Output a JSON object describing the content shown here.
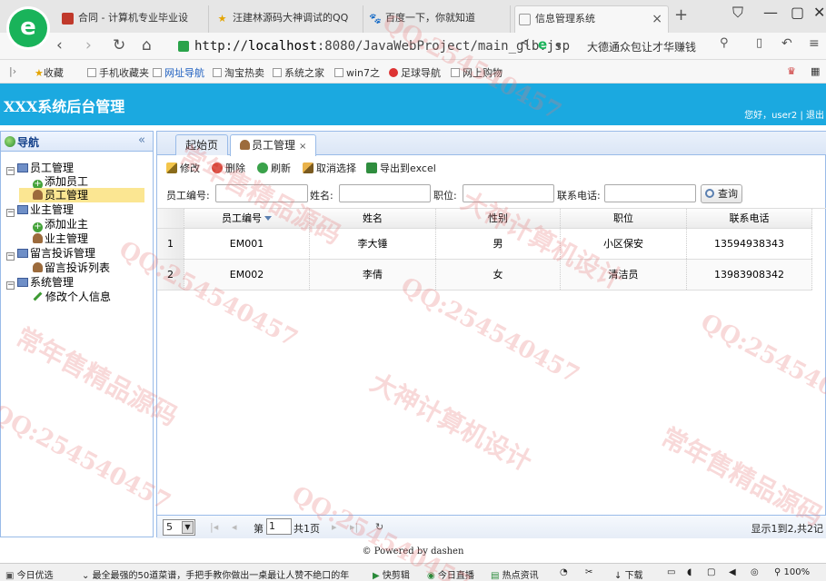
{
  "browser": {
    "tabs": [
      {
        "label": "合同 - 计算机专业毕业设"
      },
      {
        "label": "汪建林源码大神调试的QQ"
      },
      {
        "label": "百度一下，你就知道"
      },
      {
        "label": "信息管理系统",
        "active": true
      }
    ],
    "url_prefix": "http://",
    "url_host": "localhost",
    "url_path": ":8080/JavaWebProject/main_glb.jsp",
    "search_ad": "大德通众包让才华赚钱",
    "favorites": [
      "收藏",
      "手机收藏夹",
      "网址导航",
      "淘宝热卖",
      "系统之家",
      "win7之",
      "足球导航",
      "网上购物"
    ]
  },
  "app": {
    "title": "XXX系统后台管理",
    "user_info": "您好，user2 | 退出"
  },
  "sidebar": {
    "title": "导航",
    "collapse": "«",
    "tree": [
      {
        "label": "员工管理",
        "level": 0,
        "icon": "pc-icon"
      },
      {
        "label": "添加员工",
        "level": 1,
        "icon": "add-icon"
      },
      {
        "label": "员工管理",
        "level": 1,
        "icon": "user-icon",
        "selected": true
      },
      {
        "label": "业主管理",
        "level": 0,
        "icon": "pc-icon"
      },
      {
        "label": "添加业主",
        "level": 1,
        "icon": "add-icon"
      },
      {
        "label": "业主管理",
        "level": 1,
        "icon": "user-icon"
      },
      {
        "label": "留言投诉管理",
        "level": 0,
        "icon": "pc-icon"
      },
      {
        "label": "留言投诉列表",
        "level": 1,
        "icon": "user-icon"
      },
      {
        "label": "系统管理",
        "level": 0,
        "icon": "pc-icon"
      },
      {
        "label": "修改个人信息",
        "level": 1,
        "icon": "pen-icon"
      }
    ]
  },
  "main": {
    "tabs": [
      {
        "label": "起始页"
      },
      {
        "label": "员工管理",
        "active": true,
        "close": "×"
      }
    ],
    "toolbar": {
      "edit": "修改",
      "delete": "删除",
      "refresh": "刷新",
      "cancel_select": "取消选择",
      "export": "导出到excel"
    },
    "search": {
      "emp_no_label": "员工编号:",
      "name_label": "姓名:",
      "position_label": "职位:",
      "phone_label": "联系电话:",
      "query_label": "查询"
    },
    "grid": {
      "columns": [
        "员工编号",
        "姓名",
        "性别",
        "职位",
        "联系电话"
      ],
      "rows": [
        {
          "num": "1",
          "cells": [
            "EM001",
            "李大锤",
            "男",
            "小区保安",
            "13594938343"
          ]
        },
        {
          "num": "2",
          "cells": [
            "EM002",
            "李倩",
            "女",
            "清洁员",
            "13983908342"
          ]
        }
      ]
    },
    "pager": {
      "page_size": "5",
      "page_label_pre": "第",
      "page_value": "1",
      "page_label_post": "共1页",
      "info": "显示1到2,共2记"
    }
  },
  "footer": "© Powered by dashen",
  "statusbar": {
    "left": "今日优选",
    "news": "最全最强的50道菜谱，手把手教你做出一桌最让人赞不绝口的年",
    "items": [
      "快剪辑",
      "今日直播",
      "热点资讯",
      "下载",
      "100%"
    ]
  },
  "watermarks": [
    "QQ:254540457",
    "常年售精品源码",
    "大神计算机设计"
  ]
}
